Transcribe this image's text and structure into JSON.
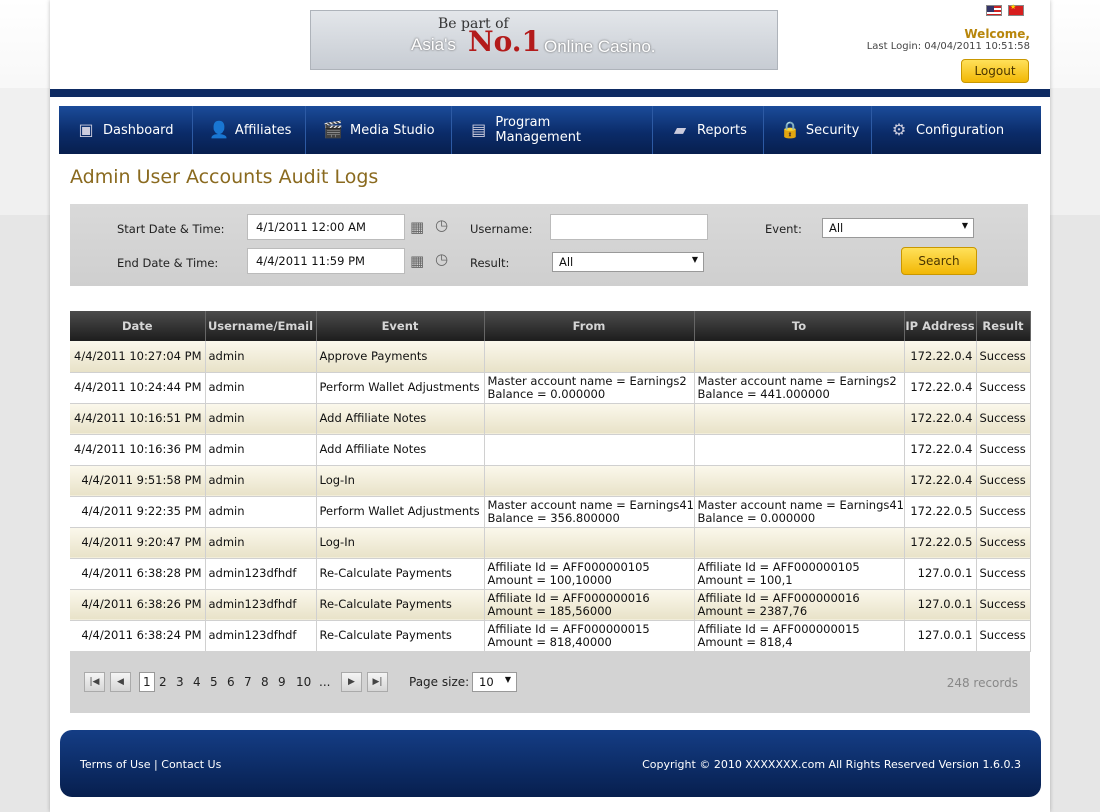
{
  "header": {
    "banner_line1": "Be part of",
    "banner_asias": "Asia's",
    "banner_no1": "No.1",
    "banner_tail": "Online Casino.",
    "welcome": "Welcome,",
    "last_login": "Last Login: 04/04/2011 10:51:58",
    "logout": "Logout"
  },
  "nav": {
    "items": [
      {
        "label": "Dashboard",
        "icon": "dashboard-icon"
      },
      {
        "label": "Affiliates",
        "icon": "user-icon"
      },
      {
        "label": "Media Studio",
        "icon": "clapperboard-icon"
      },
      {
        "label": "Program Management",
        "icon": "chart-icon"
      },
      {
        "label": "Reports",
        "icon": "report-icon"
      },
      {
        "label": "Security",
        "icon": "lock-icon"
      },
      {
        "label": "Configuration",
        "icon": "gear-icon"
      }
    ]
  },
  "page_title": "Admin User Accounts Audit Logs",
  "filter": {
    "start_label": "Start Date & Time:",
    "start_value": "4/1/2011 12:00 AM",
    "end_label": "End Date & Time:",
    "end_value": "4/4/2011 11:59 PM",
    "username_label": "Username:",
    "username_value": "",
    "result_label": "Result:",
    "result_value": "All",
    "event_label": "Event:",
    "event_value": "All",
    "search": "Search"
  },
  "table": {
    "headers": [
      "Date",
      "Username/Email",
      "Event",
      "From",
      "To",
      "IP Address",
      "Result"
    ],
    "rows": [
      {
        "date": "4/4/2011 10:27:04 PM",
        "user": "admin",
        "event": "Approve Payments",
        "from1": "",
        "from2": "",
        "to1": "",
        "to2": "",
        "ip": "172.22.0.4",
        "result": "Success"
      },
      {
        "date": "4/4/2011 10:24:44 PM",
        "user": "admin",
        "event": "Perform Wallet Adjustments",
        "from1": "Master account name = Earnings2",
        "from2": "Balance = 0.000000",
        "to1": "Master account name = Earnings2",
        "to2": "Balance = 441.000000",
        "ip": "172.22.0.4",
        "result": "Success"
      },
      {
        "date": "4/4/2011 10:16:51 PM",
        "user": "admin",
        "event": "Add Affiliate Notes",
        "from1": "",
        "from2": "",
        "to1": "",
        "to2": "",
        "ip": "172.22.0.4",
        "result": "Success"
      },
      {
        "date": "4/4/2011 10:16:36 PM",
        "user": "admin",
        "event": "Add Affiliate Notes",
        "from1": "",
        "from2": "",
        "to1": "",
        "to2": "",
        "ip": "172.22.0.4",
        "result": "Success"
      },
      {
        "date": "4/4/2011 9:51:58 PM",
        "user": "admin",
        "event": "Log-In",
        "from1": "",
        "from2": "",
        "to1": "",
        "to2": "",
        "ip": "172.22.0.4",
        "result": "Success"
      },
      {
        "date": "4/4/2011 9:22:35 PM",
        "user": "admin",
        "event": "Perform Wallet Adjustments",
        "from1": "Master account name = Earnings41",
        "from2": "Balance = 356.800000",
        "to1": "Master account name = Earnings41",
        "to2": "Balance = 0.000000",
        "ip": "172.22.0.5",
        "result": "Success"
      },
      {
        "date": "4/4/2011 9:20:47 PM",
        "user": "admin",
        "event": "Log-In",
        "from1": "",
        "from2": "",
        "to1": "",
        "to2": "",
        "ip": "172.22.0.5",
        "result": "Success"
      },
      {
        "date": "4/4/2011 6:38:28 PM",
        "user": "admin123dfhdf",
        "event": "Re-Calculate Payments",
        "from1": "Affiliate Id = AFF000000105",
        "from2": "Amount = 100,10000",
        "to1": "Affiliate Id = AFF000000105",
        "to2": "Amount = 100,1",
        "ip": "127.0.0.1",
        "result": "Success"
      },
      {
        "date": "4/4/2011 6:38:26 PM",
        "user": "admin123dfhdf",
        "event": "Re-Calculate Payments",
        "from1": "Affiliate Id = AFF000000016",
        "from2": "Amount = 185,56000",
        "to1": "Affiliate Id = AFF000000016",
        "to2": "Amount = 2387,76",
        "ip": "127.0.0.1",
        "result": "Success"
      },
      {
        "date": "4/4/2011 6:38:24 PM",
        "user": "admin123dfhdf",
        "event": "Re-Calculate Payments",
        "from1": "Affiliate Id = AFF000000015",
        "from2": "Amount = 818,40000",
        "to1": "Affiliate Id = AFF000000015",
        "to2": "Amount = 818,4",
        "ip": "127.0.0.1",
        "result": "Success"
      }
    ]
  },
  "pager": {
    "pages": [
      "1",
      "2",
      "3",
      "4",
      "5",
      "6",
      "7",
      "8",
      "9",
      "10",
      "..."
    ],
    "current": "1",
    "page_size_label": "Page size:",
    "page_size": "10",
    "records": "248 records"
  },
  "footer": {
    "terms": "Terms of Use",
    "sep": "|",
    "contact": "Contact Us",
    "copyright": "Copyright © 2010 XXXXXXX.com All Rights Reserved  Version 1.6.0.3"
  }
}
